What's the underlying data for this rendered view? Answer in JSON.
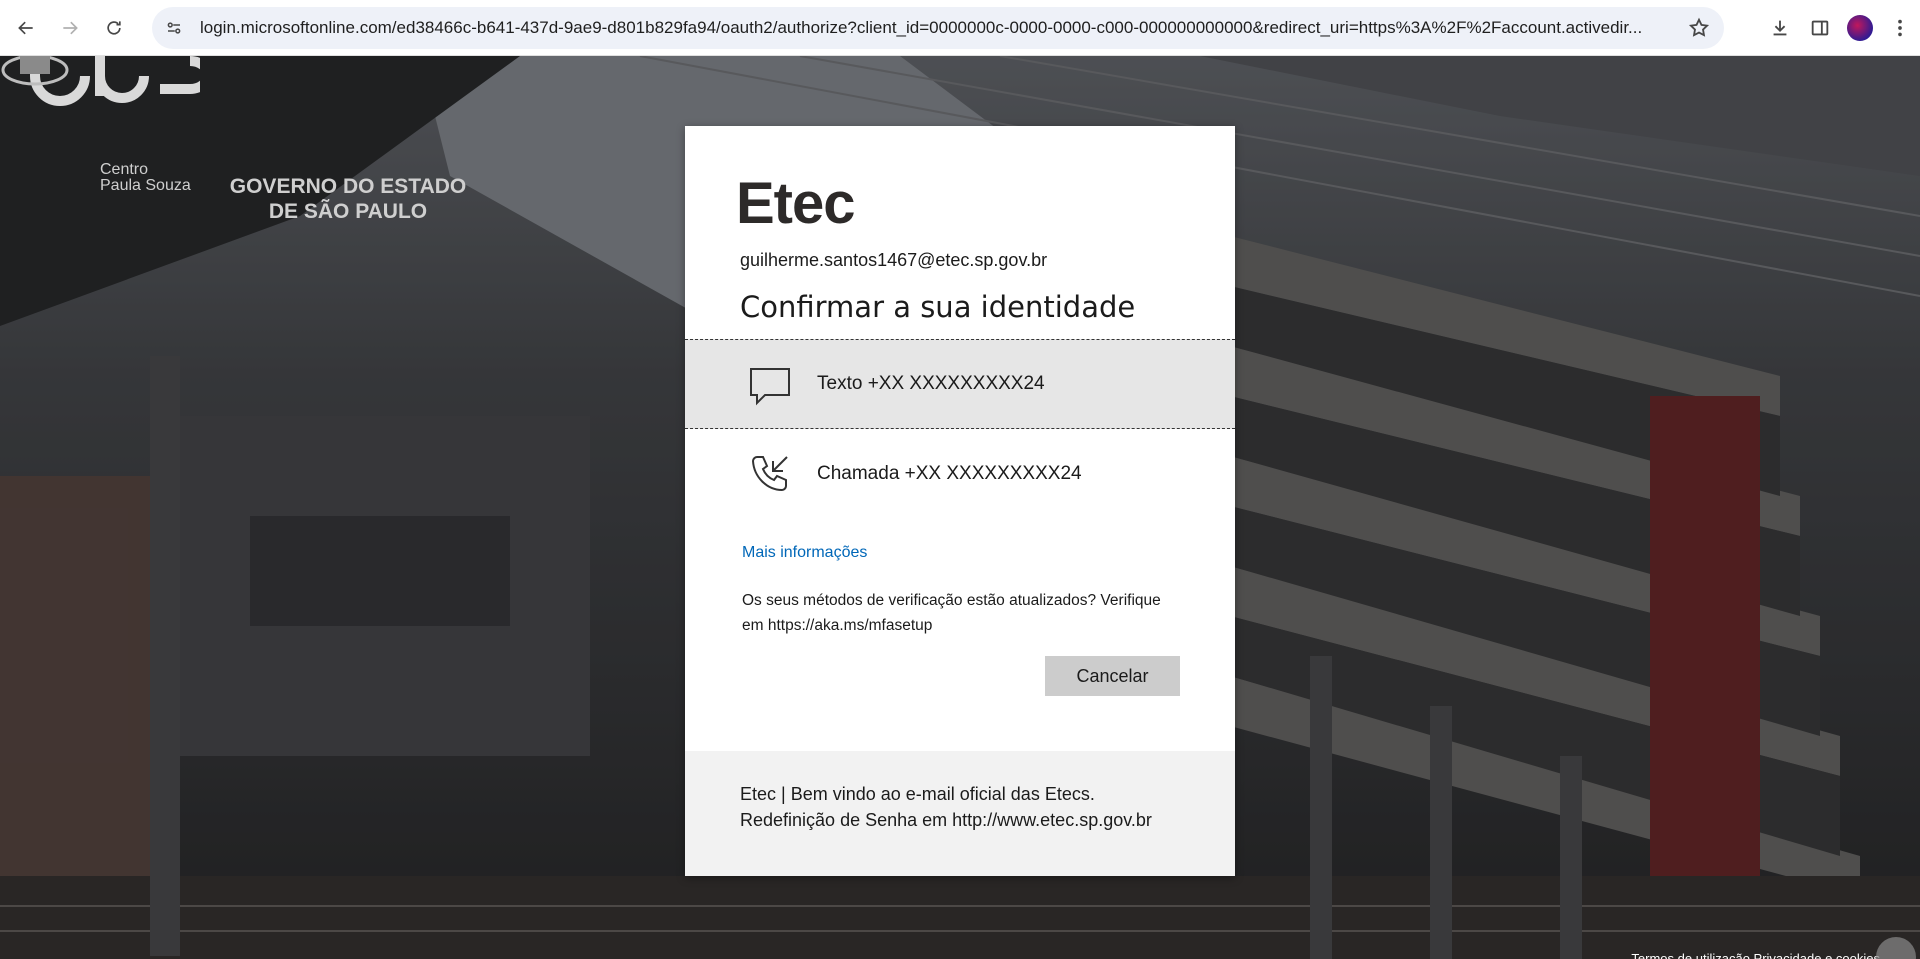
{
  "browser": {
    "url": "login.microsoftonline.com/ed38466c-b641-437d-9ae9-d801b829fa94/oauth2/authorize?client_id=0000000c-0000-0000-c000-000000000000&redirect_uri=https%3A%2F%2Faccount.activedir...",
    "icons": [
      "back-icon",
      "forward-icon",
      "reload-icon",
      "site-info-icon",
      "bookmark-star-icon",
      "download-icon",
      "side-panel-icon",
      "profile-avatar",
      "kebab-menu-icon"
    ]
  },
  "logos": {
    "cps_line1": "Centro",
    "cps_line2": "Paula Souza",
    "gov_line1": "GOVERNO DO ESTADO",
    "gov_line2": "DE SÃO PAULO"
  },
  "dialog": {
    "brand": "Etec",
    "email": "guilherme.santos1467@etec.sp.gov.br",
    "title": "Confirmar a sua identidade",
    "options": [
      {
        "label": "Texto +XX XXXXXXXXX24",
        "icon": "message-icon",
        "selected": true
      },
      {
        "label": "Chamada +XX XXXXXXXXX24",
        "icon": "phone-call-icon",
        "selected": false
      }
    ],
    "more_info": "Mais informações",
    "methods_note": "Os seus métodos de verificação estão atualizados? Verifique em https://aka.ms/mfasetup",
    "cancel": "Cancelar",
    "footer_line1": "Etec | Bem vindo ao e-mail oficial das Etecs.",
    "footer_line2": "Redefinição de Senha em http://www.etec.sp.gov.br"
  },
  "colors": {
    "link": "#0067b8",
    "selected_option_bg": "#e6e6e6",
    "button_bg": "#cccccc"
  }
}
